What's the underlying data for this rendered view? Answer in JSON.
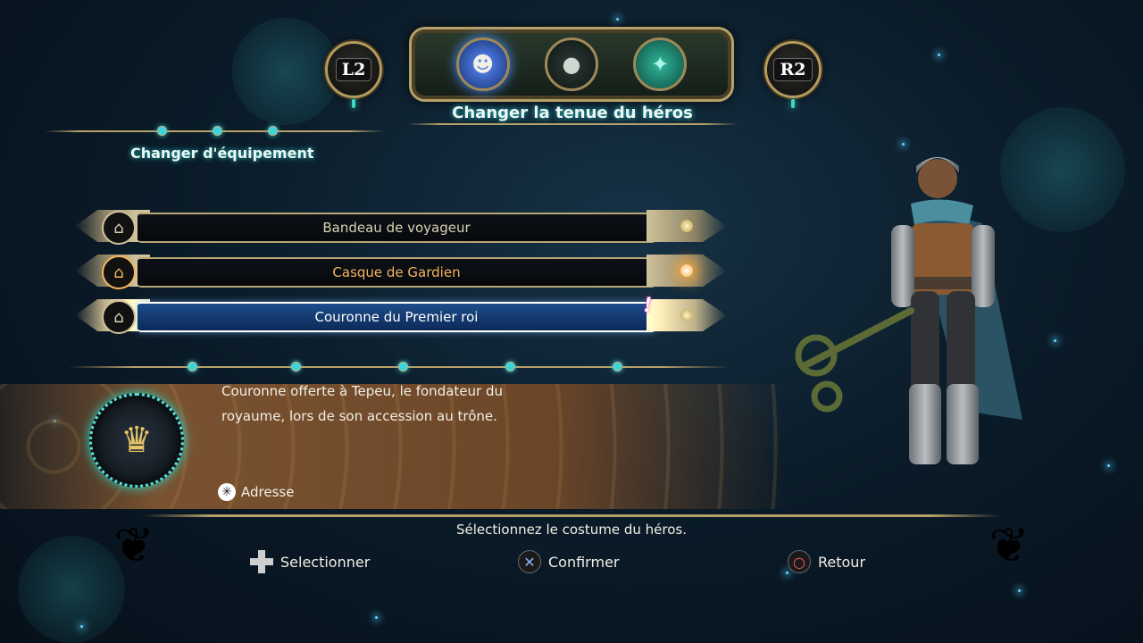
{
  "header": {
    "left_shoulder": "L2",
    "right_shoulder": "R2",
    "category_title": "Changer la tenue du héros"
  },
  "section_title": "Changer d'équipement",
  "equipment": [
    {
      "name": "Bandeau de voyageur",
      "state": "normal"
    },
    {
      "name": "Casque de Gardien",
      "state": "equipped"
    },
    {
      "name": "Couronne du Premier roi",
      "state": "selected"
    }
  ],
  "new_marker": "!",
  "description": {
    "line1": "Couronne offerte à Tepeu, le fondateur du",
    "line2": "royaume, lors de son accession au trône.",
    "address_label": "Adresse",
    "icon": "crown-icon"
  },
  "help": {
    "text": "Sélectionnez le costume du héros.",
    "select": "Selectionner",
    "confirm": "Confirmer",
    "back": "Retour"
  },
  "colors": {
    "accent_teal": "#2bd4d4",
    "equipped_orange": "#f6b45a",
    "selected_blue": "#1e4c8a",
    "gold_frame": "#b7a069"
  }
}
